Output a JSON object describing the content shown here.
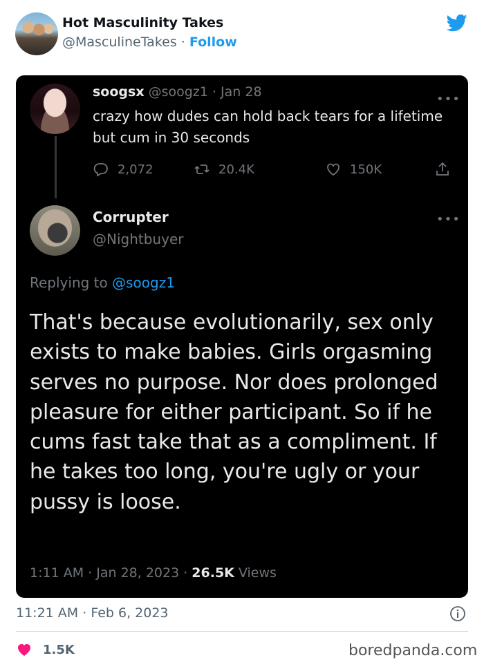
{
  "embed": {
    "account_name": "Hot Masculinity Takes",
    "account_handle": "@MasculineTakes",
    "separator": " · ",
    "follow_label": "Follow",
    "posted_time": "11:21 AM",
    "posted_date": "Feb 6, 2023",
    "likes": "1.5K"
  },
  "quoted_tweet": {
    "name": "soogsx",
    "handle": "@soogz1",
    "date": "Jan 28",
    "text": "crazy how dudes can hold back tears for a lifetime but cum in 30 seconds",
    "replies": "2,072",
    "retweets": "20.4K",
    "likes": "150K"
  },
  "reply_tweet": {
    "name": "Corrupter",
    "handle": "@Nightbuyer",
    "replying_prefix": "Replying to ",
    "replying_handle": "@soogz1",
    "text": "That's because evolutionarily, sex only exists to make babies. Girls orgasming serves no purpose. Nor does prolonged pleasure for either participant. So if he cums fast take that as a compliment. If he takes too long, you're ugly or your pussy is loose.",
    "time": "1:11 AM",
    "date": "Jan 28, 2023",
    "views_count": "26.5K",
    "views_label": "Views"
  },
  "watermark": "boredpanda.com",
  "colors": {
    "twitter_blue": "#1d9bf0",
    "card_bg": "#000000",
    "like_pink": "#f91880"
  },
  "icons": [
    "twitter-bird-icon",
    "more-icon",
    "reply-icon",
    "retweet-icon",
    "like-icon",
    "share-icon",
    "info-icon",
    "heart-icon"
  ]
}
